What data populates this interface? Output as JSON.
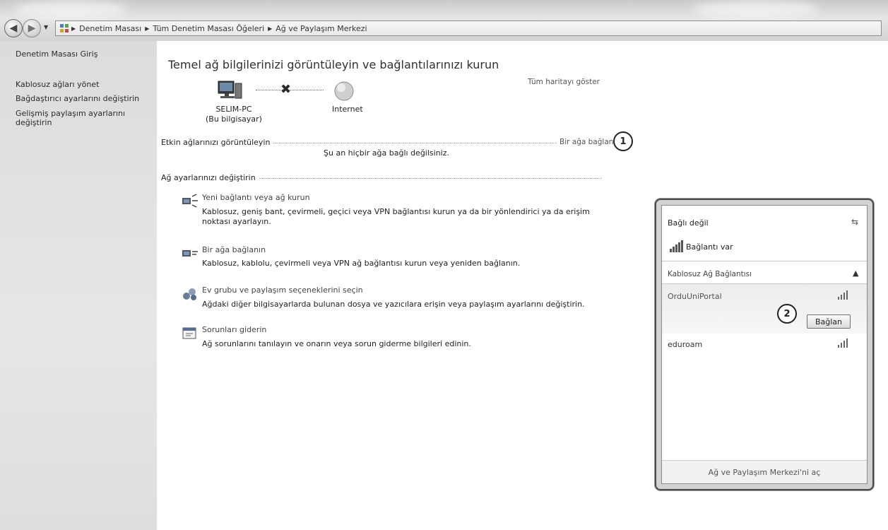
{
  "breadcrumb": {
    "items": [
      "Denetim Masası",
      "Tüm Denetim Masası Öğeleri",
      "Ağ ve Paylaşım Merkezi"
    ]
  },
  "sidebar": {
    "items": [
      {
        "label": "Denetim Masası Giriş"
      },
      {
        "label": "Kablosuz ağları yönet"
      },
      {
        "label": "Bağdaştırıcı ayarlarını değiştirin"
      },
      {
        "label": "Gelişmiş paylaşım ayarlarını"
      },
      {
        "label": "değiştirin"
      }
    ]
  },
  "main": {
    "title": "Temel ağ bilgilerinizi görüntüleyin ve bağlantılarınızı kurun",
    "show_map": "Tüm haritayı göster",
    "map": {
      "computer_name": "SELIM-PC",
      "computer_sub": "(Bu bilgisayar)",
      "internet_label": "Internet",
      "status": "disconnected"
    },
    "active_networks": {
      "heading": "Etkin ağlarınızı görüntüleyin",
      "connect_link": "Bir ağa bağlan",
      "empty_text": "Şu an hiçbir ağa bağlı değilsiniz."
    },
    "change_settings": {
      "heading": "Ağ ayarlarınızı değiştirin",
      "tasks": [
        {
          "title": "Yeni bağlantı veya ağ kurun",
          "desc_line1": "Kablosuz, geniş bant, çevirmeli, geçici veya VPN bağlantısı kurun ya da bir yönlendirici ya da erişim",
          "desc_line2": "noktası ayarlayın.",
          "icon": "network-setup-icon"
        },
        {
          "title": "Bir ağa bağlanın",
          "desc_line1": "Kablosuz, kablolu, çevirmeli veya VPN ağ bağlantısı kurun veya yeniden bağlanın.",
          "desc_line2": "",
          "icon": "connect-network-icon"
        },
        {
          "title": "Ev grubu ve paylaşım seçeneklerini seçin",
          "desc_line1": "Ağdaki diğer bilgisayarlarda bulunan dosya ve yazıcılara erişin veya paylaşım ayarlarını değiştirin.",
          "desc_line2": "",
          "icon": "homegroup-icon"
        },
        {
          "title": "Sorunları giderin",
          "desc_line1": "Ağ sorunlarını tanılayın ve onarın veya sorun giderme bilgileri edinin.",
          "desc_line2": "",
          "icon": "troubleshoot-icon"
        }
      ]
    }
  },
  "annotations": {
    "step1": "1",
    "step2": "2"
  },
  "wifi_popup": {
    "status": "Bağlı değil",
    "available": "Bağlantı var",
    "section": "Kablosuz Ağ Bağlantısı",
    "networks": [
      {
        "name": "OrduUniPortal",
        "selected": true,
        "signal": "signal-full-icon"
      },
      {
        "name": "eduroam",
        "selected": false,
        "signal": "signal-full-icon"
      }
    ],
    "connect_button": "Bağlan",
    "footer_link": "Ağ ve Paylaşım Merkezi'ni aç"
  },
  "colors": {
    "sidebar_bg": "#e1e1e1",
    "text": "#222222",
    "link_gray": "#555555"
  }
}
